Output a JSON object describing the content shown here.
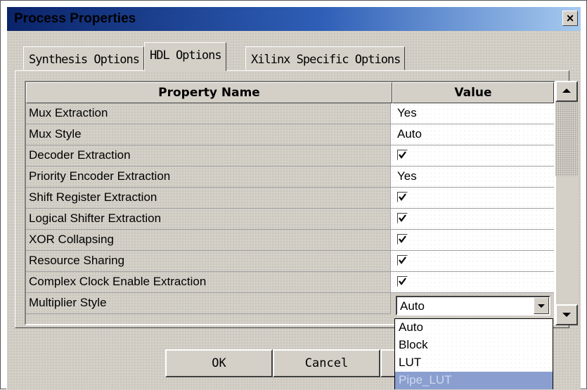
{
  "window": {
    "title": "Process Properties",
    "close_label": "×"
  },
  "tabs": [
    {
      "label": "Synthesis Options"
    },
    {
      "label": "HDL Options"
    },
    {
      "label": "Xilinx Specific Options"
    }
  ],
  "grid": {
    "headers": {
      "name": "Property Name",
      "value": "Value"
    },
    "rows": [
      {
        "name": "Mux Extraction",
        "value": "Yes"
      },
      {
        "name": "Mux Style",
        "value": "Auto"
      },
      {
        "name": "Decoder Extraction",
        "checked": true
      },
      {
        "name": "Priority Encoder Extraction",
        "value": "Yes"
      },
      {
        "name": "Shift Register Extraction",
        "checked": true
      },
      {
        "name": "Logical Shifter Extraction",
        "checked": true
      },
      {
        "name": "XOR Collapsing",
        "checked": true
      },
      {
        "name": "Resource Sharing",
        "checked": true
      },
      {
        "name": "Complex Clock Enable Extraction",
        "checked": true
      },
      {
        "name": "Multiplier Style",
        "value": "Auto"
      }
    ]
  },
  "dropdown": {
    "options": [
      "Auto",
      "Block",
      "LUT",
      "Pipe_LUT"
    ],
    "highlighted": "Pipe_LUT"
  },
  "buttons": {
    "ok": "OK",
    "cancel": "Cancel"
  },
  "colors": {
    "title_gradient_start": "#0a246a",
    "title_gradient_end": "#a6caf0",
    "face": "#d4d0c8",
    "highlight": "#8a9fcf"
  }
}
